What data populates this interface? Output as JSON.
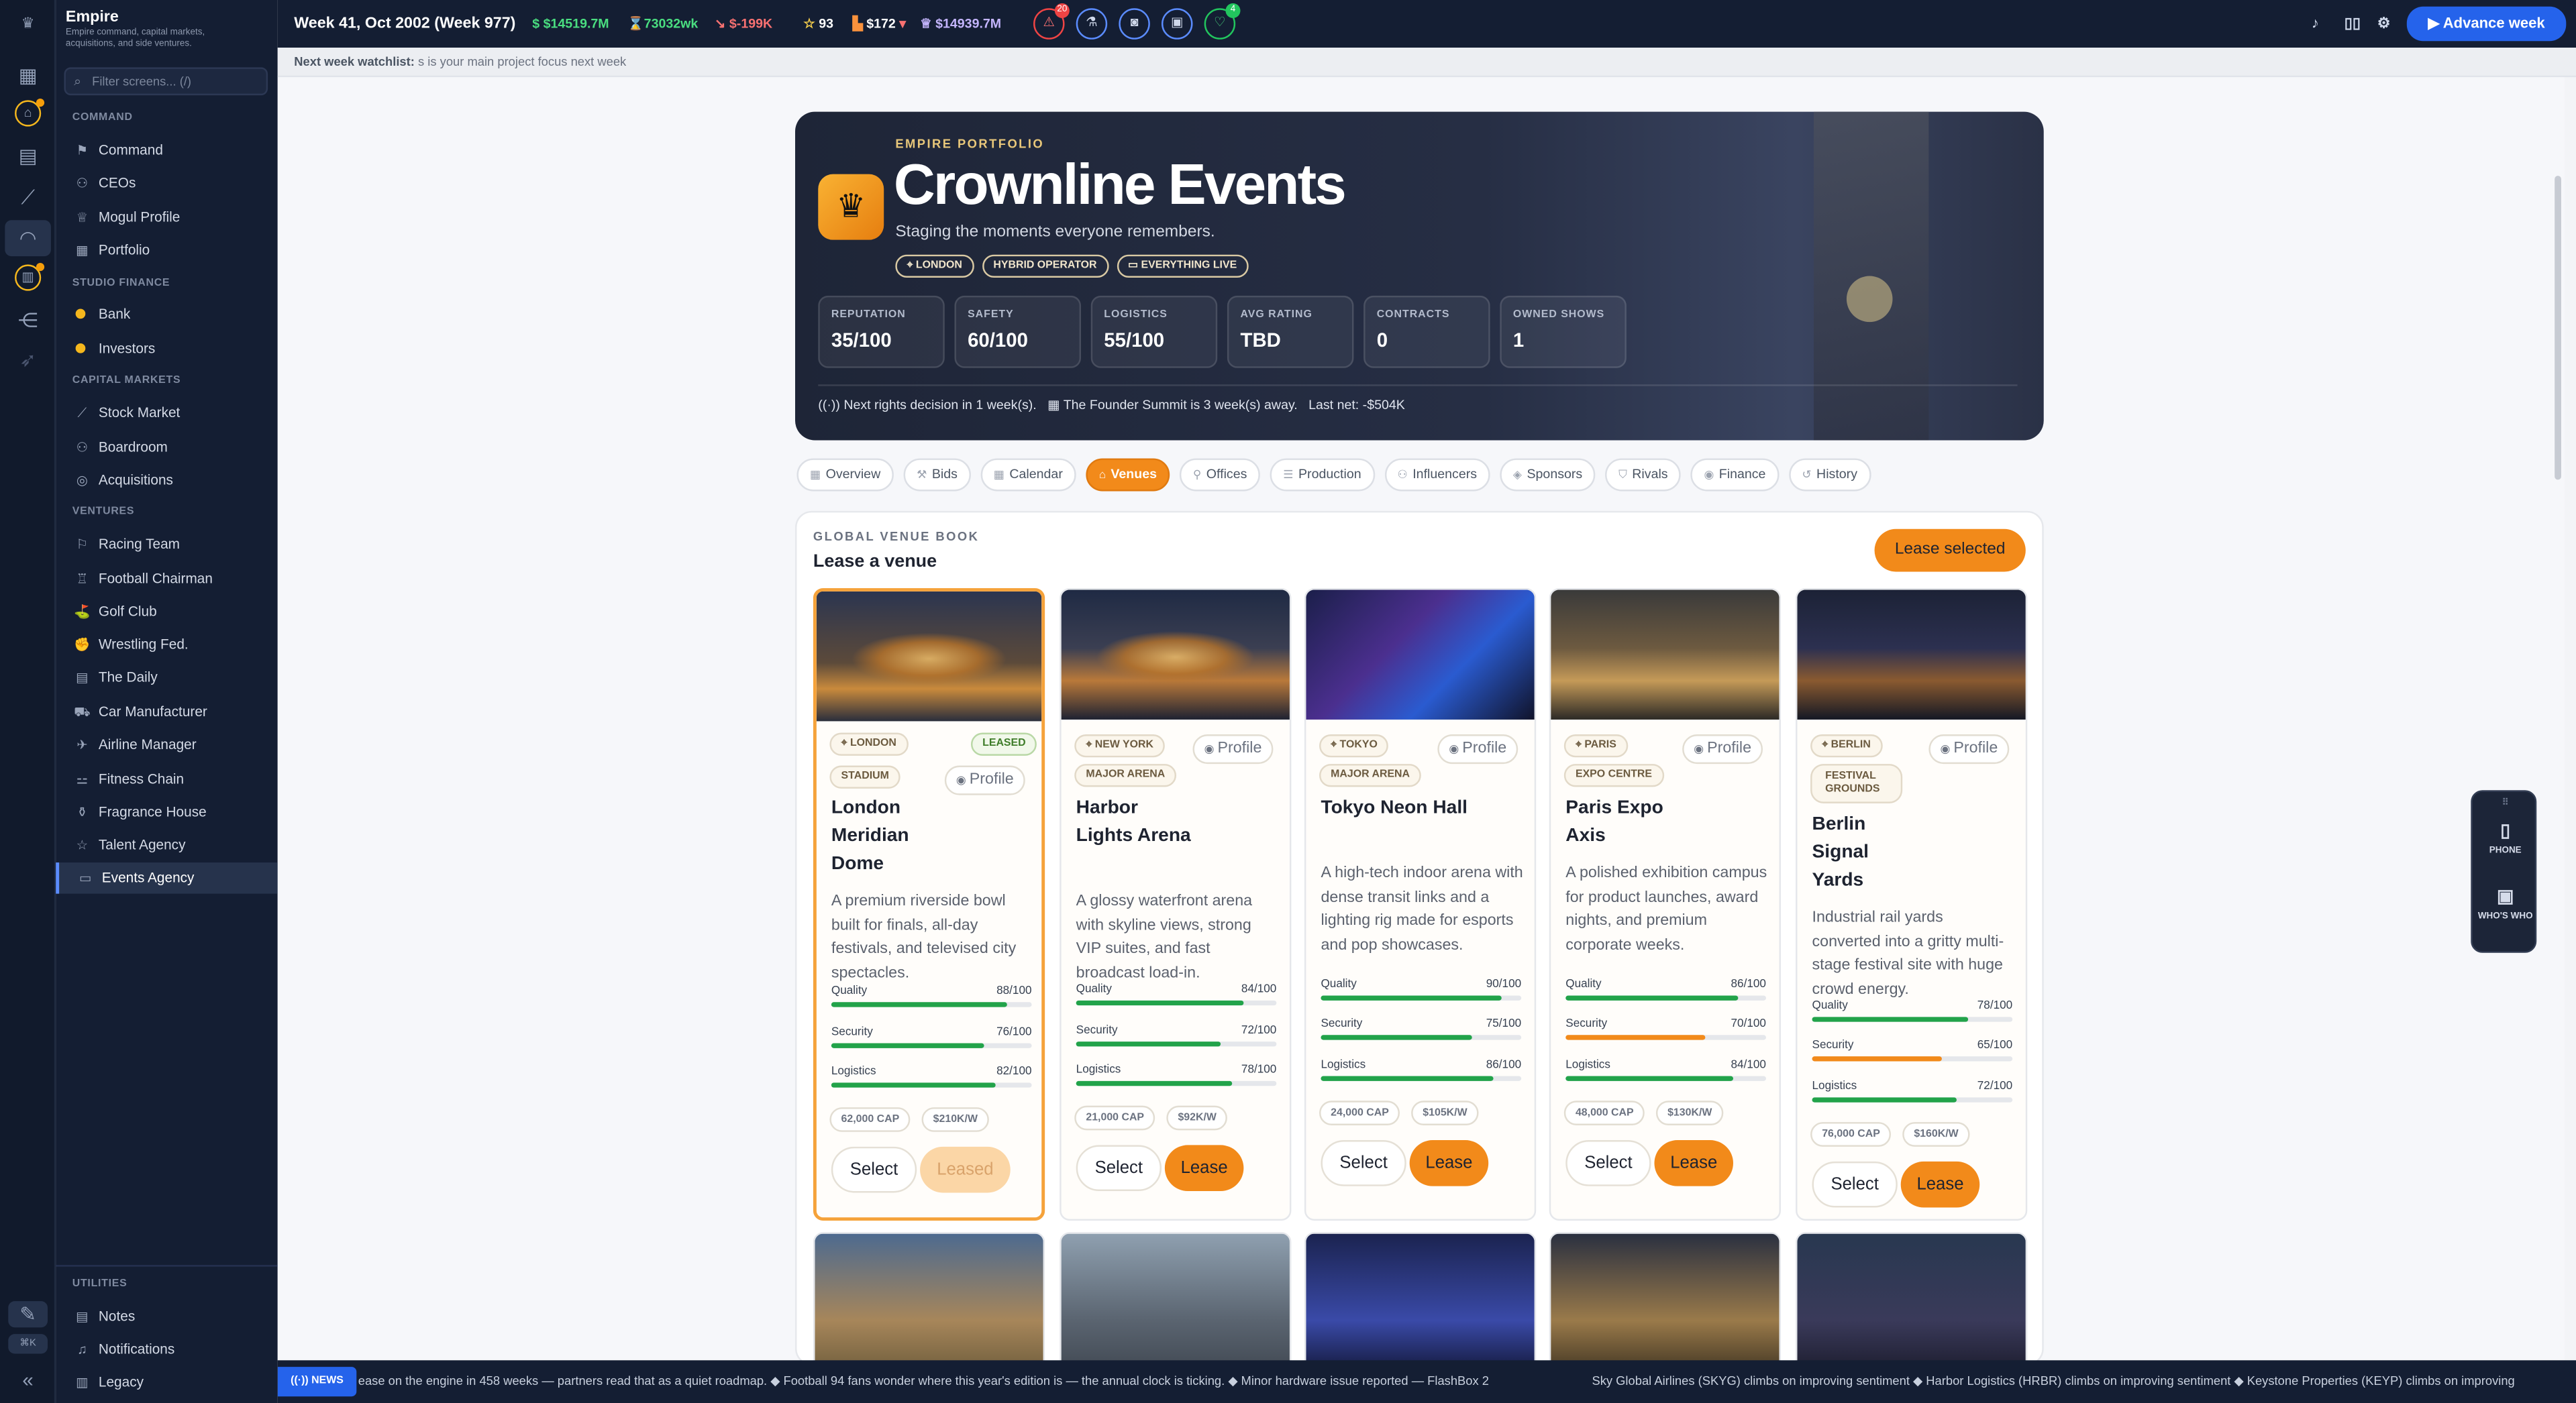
{
  "sidebar": {
    "app_title": "Empire",
    "app_subtitle": "Empire command, capital markets, acquisitions, and side ventures.",
    "search_placeholder": "Filter screens... (/)",
    "sections": [
      {
        "heading": "COMMAND",
        "items": [
          "Command",
          "CEOs",
          "Mogul Profile",
          "Portfolio"
        ]
      },
      {
        "heading": "STUDIO FINANCE",
        "items": [
          "Bank",
          "Investors"
        ]
      },
      {
        "heading": "CAPITAL MARKETS",
        "items": [
          "Stock Market",
          "Boardroom",
          "Acquisitions"
        ]
      },
      {
        "heading": "VENTURES",
        "items": [
          "Racing Team",
          "Football Chairman",
          "Golf Club",
          "Wrestling Fed.",
          "The Daily",
          "Car Manufacturer",
          "Airline Manager",
          "Fitness Chain",
          "Fragrance House",
          "Talent Agency",
          "Events Agency"
        ]
      },
      {
        "heading": "UTILITIES",
        "items": [
          "Notes",
          "Notifications",
          "Legacy"
        ]
      }
    ],
    "active": "Events Agency",
    "shortcut": "⌘K"
  },
  "topbar": {
    "week": "Week 41, Oct 2002 (Week 977)",
    "cash": "$14519.7M",
    "weekly": "73032wk",
    "net": "$-199K",
    "stars": "93",
    "price": "$172",
    "networth": "$14939.7M",
    "alert_badge": "20",
    "health_badge": "4",
    "advance_label": "Advance week"
  },
  "watchlist": {
    "label": "Next week watchlist:",
    "text": "s is your main project focus next week"
  },
  "hero": {
    "eyebrow": "EMPIRE PORTFOLIO",
    "title": "Crownline Events",
    "tagline": "Staging the moments everyone remembers.",
    "chips": [
      "LONDON",
      "HYBRID OPERATOR",
      "EVERYTHING LIVE"
    ],
    "stats": [
      {
        "label": "REPUTATION",
        "value": "35/100"
      },
      {
        "label": "SAFETY",
        "value": "60/100"
      },
      {
        "label": "LOGISTICS",
        "value": "55/100"
      },
      {
        "label": "AVG RATING",
        "value": "TBD"
      },
      {
        "label": "CONTRACTS",
        "value": "0"
      },
      {
        "label": "OWNED SHOWS",
        "value": "1"
      }
    ],
    "footer_rights": "Next rights decision in 1 week(s).",
    "footer_summit": "The Founder Summit is 3 week(s) away.",
    "footer_net": "Last net: -$504K"
  },
  "tabs": [
    "Overview",
    "Bids",
    "Calendar",
    "Venues",
    "Offices",
    "Production",
    "Influencers",
    "Sponsors",
    "Rivals",
    "Finance",
    "History"
  ],
  "active_tab": "Venues",
  "venues": {
    "eyebrow": "GLOBAL VENUE BOOK",
    "title": "Lease a venue",
    "lease_selected_label": "Lease selected",
    "profile_label": "Profile",
    "select_label": "Select",
    "leased_label": "LEASED",
    "cards": [
      {
        "city": "LONDON",
        "type": "STADIUM",
        "name": "London Meridian Dome",
        "desc": "A premium riverside bowl built for finals, all-day festivals, and televised city spectacles.",
        "quality": 88,
        "security": 76,
        "logistics": 82,
        "quality_label": "88/100",
        "security_label": "76/100",
        "logistics_label": "82/100",
        "cap": "62,000 CAP",
        "price": "$210K/W",
        "leased": true,
        "action": "Leased"
      },
      {
        "city": "NEW YORK",
        "type": "MAJOR ARENA",
        "name": "Harbor Lights Arena",
        "desc": "A glossy waterfront arena with skyline views, strong VIP suites, and fast broadcast load-in.",
        "quality": 84,
        "security": 72,
        "logistics": 78,
        "quality_label": "84/100",
        "security_label": "72/100",
        "logistics_label": "78/100",
        "cap": "21,000 CAP",
        "price": "$92K/W",
        "leased": false,
        "action": "Lease"
      },
      {
        "city": "TOKYO",
        "type": "MAJOR ARENA",
        "name": "Tokyo Neon Hall",
        "desc": "A high-tech indoor arena with dense transit links and a lighting rig made for esports and pop showcases.",
        "quality": 90,
        "security": 75,
        "logistics": 86,
        "quality_label": "90/100",
        "security_label": "75/100",
        "logistics_label": "86/100",
        "cap": "24,000 CAP",
        "price": "$105K/W",
        "leased": false,
        "action": "Lease"
      },
      {
        "city": "PARIS",
        "type": "EXPO CENTRE",
        "name": "Paris Expo Axis",
        "desc": "A polished exhibition campus for product launches, award nights, and premium corporate weeks.",
        "quality": 86,
        "security": 70,
        "logistics": 84,
        "quality_label": "86/100",
        "security_label": "70/100",
        "logistics_label": "84/100",
        "cap": "48,000 CAP",
        "price": "$130K/W",
        "leased": false,
        "action": "Lease"
      },
      {
        "city": "BERLIN",
        "type": "FESTIVAL GROUNDS",
        "name": "Berlin Signal Yards",
        "desc": "Industrial rail yards converted into a gritty multi-stage festival site with huge crowd energy.",
        "quality": 78,
        "security": 65,
        "logistics": 72,
        "quality_label": "78/100",
        "security_label": "65/100",
        "logistics_label": "72/100",
        "cap": "76,000 CAP",
        "price": "$160K/W",
        "leased": false,
        "action": "Lease"
      }
    ],
    "metric_labels": {
      "quality": "Quality",
      "security": "Security",
      "logistics": "Logistics"
    }
  },
  "float_panel": {
    "phone": "PHONE",
    "whos_who": "WHO'S WHO"
  },
  "news": {
    "badge": "NEWS",
    "ticker_1": "ease on the engine in 458 weeks — partners read that as a quiet roadmap. ◆ Football 94 fans wonder where this year's edition is — the annual clock is ticking. ◆ Minor hardware issue reported — FlashBox 2",
    "ticker_2": "Sky Global Airlines (SKYG) climbs on improving sentiment ◆ Harbor Logistics (HRBR) climbs on improving sentiment ◆ Keystone Properties (KEYP) climbs on improving"
  }
}
